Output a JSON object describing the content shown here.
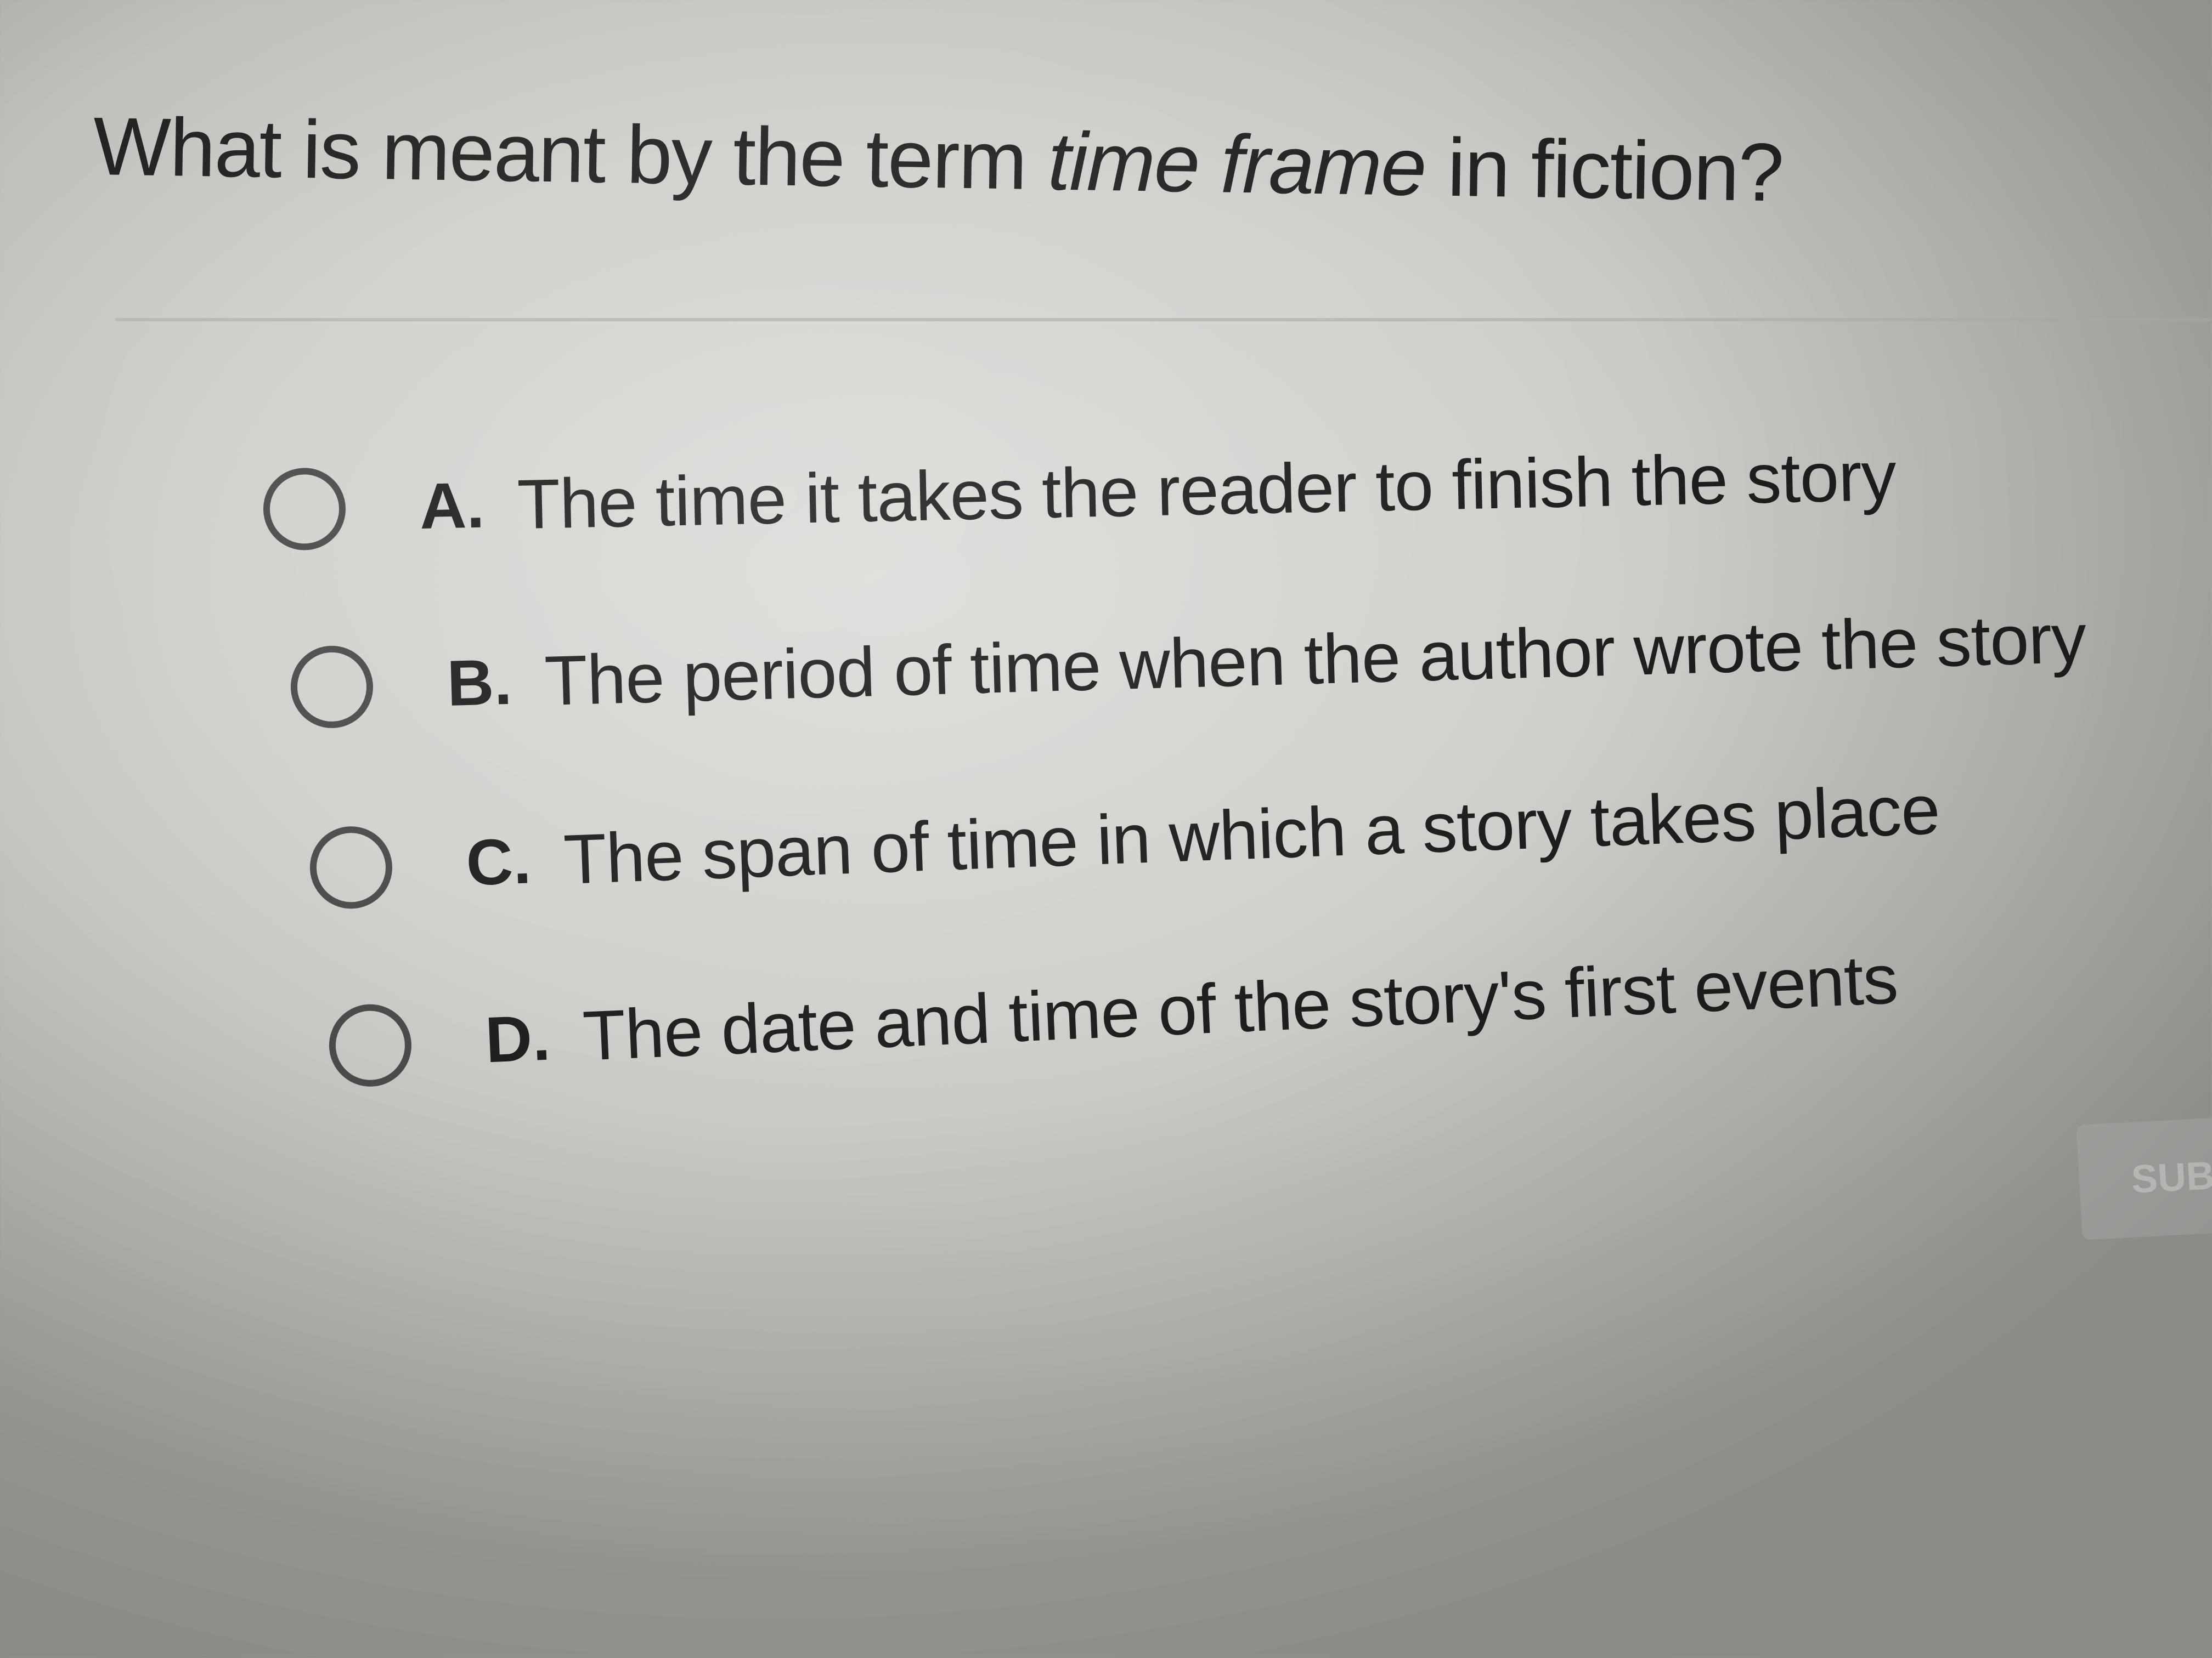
{
  "question": {
    "prefix": "What is meant by the term ",
    "emphasis": "time frame",
    "suffix": " in fiction?"
  },
  "options": [
    {
      "letter": "A.",
      "text": "The time it takes the reader to finish the story",
      "selected": false
    },
    {
      "letter": "B.",
      "text": "The period of time when the author wrote the story",
      "selected": false
    },
    {
      "letter": "C.",
      "text": "The span of time in which a story takes place",
      "selected": false
    },
    {
      "letter": "D.",
      "text": "The date and time of the story's first events",
      "selected": false
    }
  ],
  "submit": {
    "label": "SUB"
  },
  "colors": {
    "text": "#1e1e1e",
    "radio_border": "#4a4a4a",
    "submit_bg": "#b6b6b3",
    "submit_text": "#d8d8d5"
  },
  "icons": {
    "radio": "radio-unselected-icon"
  }
}
